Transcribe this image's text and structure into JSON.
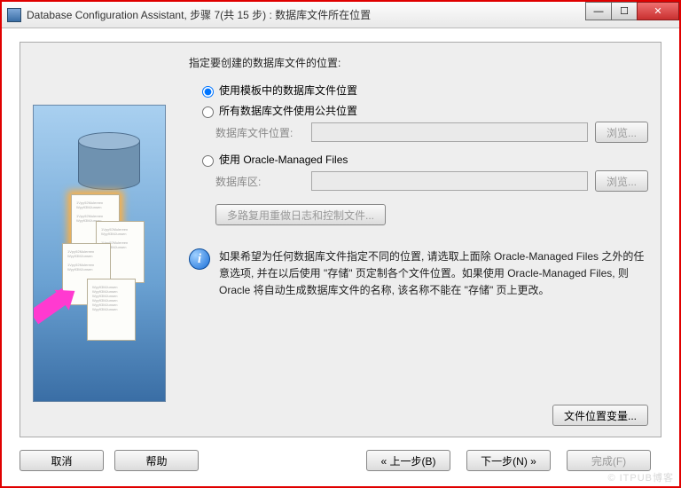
{
  "window": {
    "title": "Database Configuration Assistant, 步骤 7(共 15 步) : 数据库文件所在位置"
  },
  "main": {
    "prompt": "指定要创建的数据库文件的位置:",
    "options": {
      "opt1_label": "使用模板中的数据库文件位置",
      "opt2_label": "所有数据库文件使用公共位置",
      "opt2_field_label": "数据库文件位置:",
      "opt2_value": "",
      "opt3_label": "使用 Oracle-Managed Files",
      "opt3_field_label": "数据库区:",
      "opt3_value": "",
      "browse_label": "浏览...",
      "multiplex_label": "多路复用重做日志和控制文件..."
    },
    "info_text": "如果希望为任何数据库文件指定不同的位置, 请选取上面除 Oracle-Managed Files 之外的任意选项, 并在以后使用 \"存储\" 页定制各个文件位置。如果使用 Oracle-Managed Files, 则 Oracle 将自动生成数据库文件的名称, 该名称不能在 \"存储\" 页上更改。",
    "file_vars_label": "文件位置变量..."
  },
  "footer": {
    "cancel": "取消",
    "help": "帮助",
    "back": "上一步(B)",
    "next": "下一步(N)",
    "finish": "完成(F)"
  },
  "watermark": "© ITPUB博客"
}
